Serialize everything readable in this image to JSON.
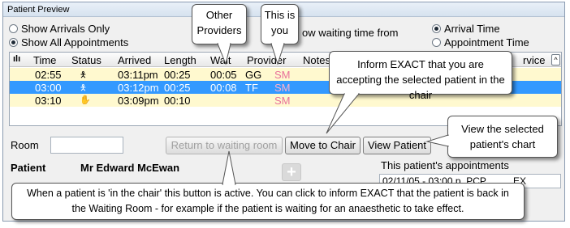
{
  "window": {
    "title": "Patient Preview"
  },
  "filters": {
    "show_arrivals_only": "Show Arrivals Only",
    "show_all_appointments": "Show All Appointments",
    "show_waiting_time_from": "ow waiting time from",
    "arrival_time": "Arrival Time",
    "appointment_time": "Appointment Time",
    "selected_filter": "Show All Appointments",
    "selected_time_basis": "Arrival Time"
  },
  "table": {
    "columns": [
      "Time",
      "Status",
      "Arrived",
      "Length",
      "Wait",
      "Provider",
      "Notes",
      "rvice"
    ],
    "rows": [
      {
        "time": "02:55",
        "status_icon": "person-icon",
        "arrived": "03:11pm",
        "length": "00:25",
        "wait": "00:05",
        "provider": "GG",
        "provider2": "SM"
      },
      {
        "time": "03:00",
        "status_icon": "person-icon",
        "arrived": "03:12pm",
        "length": "00:25",
        "wait": "00:08",
        "provider": "TF",
        "provider2": "SM"
      },
      {
        "time": "03:10",
        "status_icon": "hand-icon",
        "arrived": "03:09pm",
        "length": "00:10",
        "wait": "",
        "provider": "",
        "provider2": "SM"
      }
    ],
    "selected_row_index": 1
  },
  "room": {
    "label": "Room",
    "value": ""
  },
  "buttons": {
    "return_to_waiting_room": "Return to waiting room",
    "move_to_chair": "Move to Chair",
    "view_patient": "View Patient"
  },
  "patient": {
    "label": "Patient",
    "name": "Mr Edward McEwan"
  },
  "appointments": {
    "label": "This patient's appointments",
    "partial_row": "02/11/05 - 03:00 p  PCP          EX"
  },
  "callouts": {
    "other_providers": "Other Providers",
    "this_is_you": "This is you",
    "inform_exact": "Inform EXACT that you are accepting the selected patient in the chair",
    "view_chart": "View the selected patient's chart",
    "waiting_room_note": "When a patient is 'in the chair' this button is active. You can click to inform EXACT that the patient is back in the Waiting Room - for example if the patient is waiting for an anaesthetic to take effect."
  },
  "colors": {
    "selected_row": "#3399ff",
    "pale_row": "#fff9cf",
    "provider_you": "#e8709a"
  }
}
